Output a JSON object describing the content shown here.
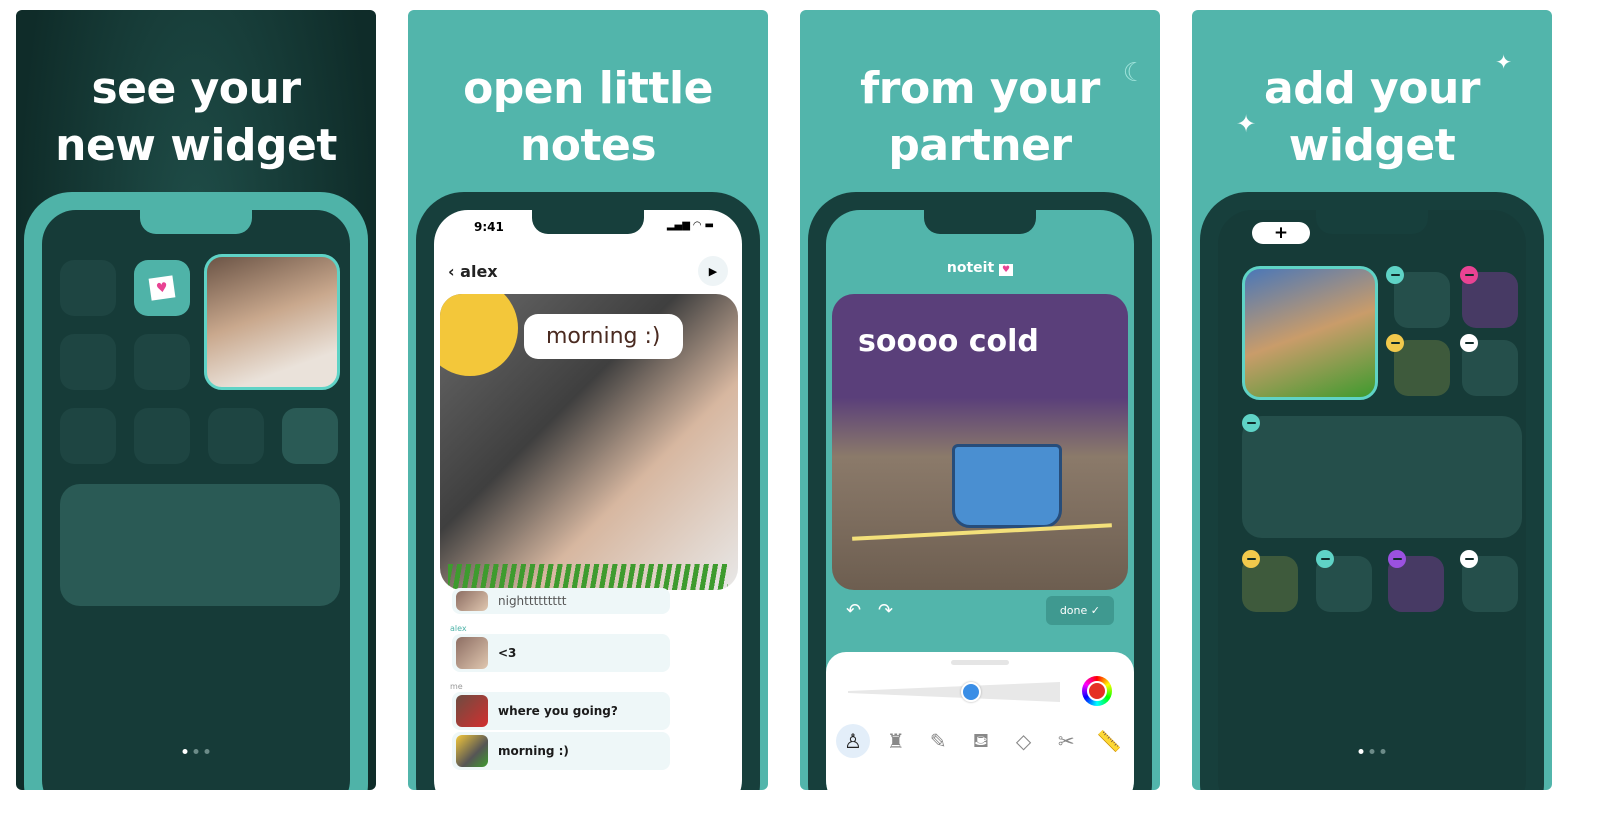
{
  "panels": [
    {
      "headline_1": "see your",
      "headline_2": "new widget"
    },
    {
      "headline_1": "open little",
      "headline_2": "notes"
    },
    {
      "headline_1": "from your",
      "headline_2": "partner"
    },
    {
      "headline_1": "add your",
      "headline_2": "widget"
    }
  ],
  "chat": {
    "time": "9:41",
    "contact": "alex",
    "back_icon": "chevron-left",
    "play_icon": "play",
    "note_caption": "morning :)",
    "messages": [
      {
        "sender": "",
        "text": "nighttttttttt"
      },
      {
        "sender": "alex",
        "text": "<3"
      },
      {
        "sender": "me",
        "text": "where you going?"
      },
      {
        "sender": "",
        "text": "morning :)"
      }
    ]
  },
  "editor": {
    "app_name": "noteit",
    "note_text": "soooo cold",
    "done_label": "done",
    "brush_size_percent": 58,
    "selected_color": "#e53025",
    "tools": [
      "marker",
      "paint",
      "pencil",
      "bucket",
      "eraser",
      "scissors",
      "ruler"
    ]
  },
  "widget_editor": {
    "add_label": "+"
  },
  "colors": {
    "teal": "#52b5ab",
    "dark": "#163b38",
    "accent_pink": "#e84393",
    "accent_yellow": "#f2c94c",
    "accent_purple": "#9b51e0"
  }
}
